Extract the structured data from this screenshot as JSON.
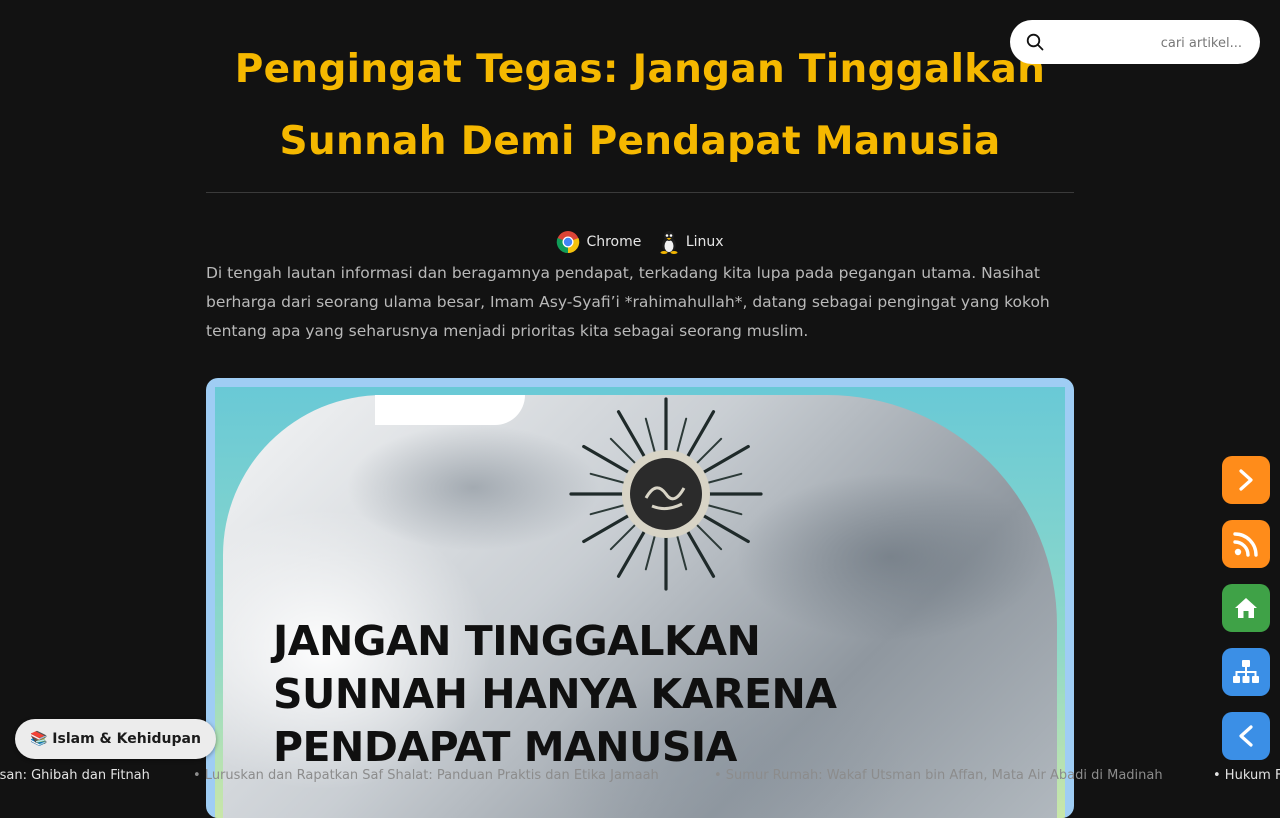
{
  "article": {
    "title_line1": "Pengingat Tegas: Jangan Tinggalkan",
    "title_line2": "Sunnah Demi Pendapat Manusia",
    "browser": "Chrome",
    "os": "Linux",
    "intro": "Di tengah lautan informasi dan beragamnya pendapat, terkadang kita lupa pada pegangan utama. Nasihat berharga dari seorang ulama besar, Imam Asy-Syafi’i *rahimahullah*, datang sebagai pengingat yang kokoh tentang apa yang seharusnya menjadi prioritas kita sebagai seorang muslim.",
    "poster_line1": "JANGAN TINGGALKAN",
    "poster_line2": "SUNNAH HANYA KARENA",
    "poster_line3": "PENDAPAT MANUSIA"
  },
  "search": {
    "placeholder": "cari artikel..."
  },
  "category": {
    "label": "📚 Islam & Kehidupan"
  },
  "ticker": {
    "items": [
      "isan: Ghibah dan Fitnah",
      "• Luruskan dan Rapatkan Saf Shalat: Panduan Praktis dan Etika Jamaah",
      "• Sumur Rumah: Wakaf Utsman bin Affan, Mata Air Abadi di Madinah",
      "• Hukum F"
    ]
  },
  "fabs": [
    {
      "icon": "chevron-right-icon",
      "color": "#ff8c1a"
    },
    {
      "icon": "rss-icon",
      "color": "#ff8c1a"
    },
    {
      "icon": "home-icon",
      "color": "#3fa247"
    },
    {
      "icon": "sitemap-icon",
      "color": "#3b8fe6"
    },
    {
      "icon": "chevron-left-icon",
      "color": "#3b8fe6"
    }
  ]
}
